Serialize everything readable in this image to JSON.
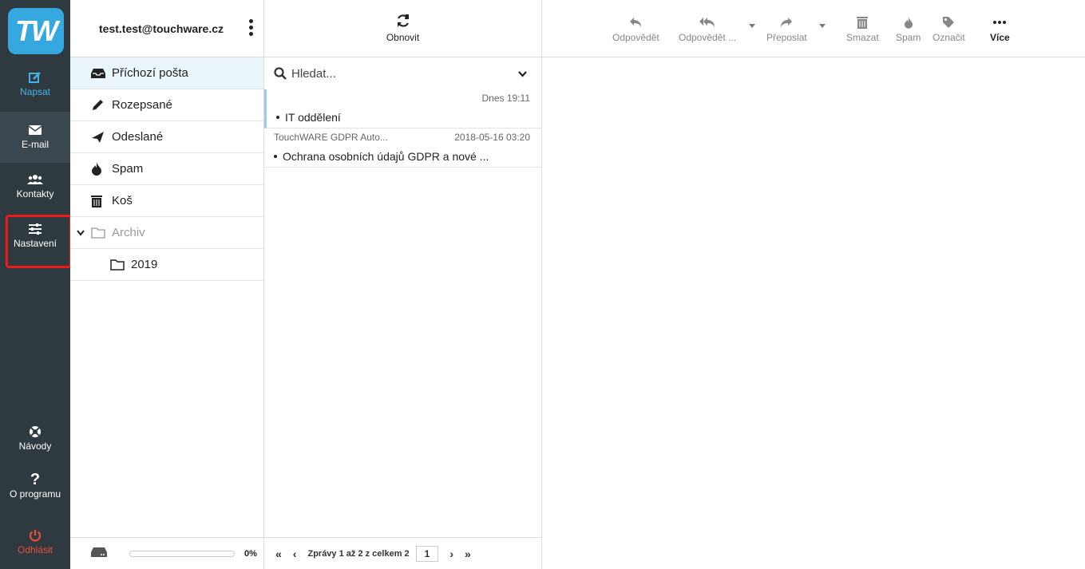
{
  "logo": "TW",
  "rail": {
    "compose": "Napsat",
    "email": "E-mail",
    "contacts": "Kontakty",
    "settings": "Nastavení",
    "guides": "Návody",
    "about": "O programu",
    "logout": "Odhlásit"
  },
  "account": "test.test@touchware.cz",
  "folders": {
    "inbox": "Příchozí pošta",
    "drafts": "Rozepsané",
    "sent": "Odeslané",
    "spam": "Spam",
    "trash": "Koš",
    "archive": "Archiv",
    "archive_2019": "2019"
  },
  "storage": {
    "percent_label": "0%",
    "used_fraction": 0
  },
  "list": {
    "refresh": "Obnovit",
    "search_placeholder": "Hledat...",
    "messages": [
      {
        "from": "",
        "date": "Dnes 19:11",
        "subject": "IT oddělení"
      },
      {
        "from": "TouchWARE GDPR Auto...",
        "date": "2018-05-16 03:20",
        "subject": "Ochrana osobních údajů GDPR a nové ..."
      }
    ],
    "pager_text": "Zprávy 1 až 2 z celkem 2",
    "page": "1"
  },
  "toolbar": {
    "reply": "Odpovědět",
    "reply_all": "Odpovědět ...",
    "forward": "Přeposlat",
    "delete": "Smazat",
    "spam": "Spam",
    "mark": "Označit",
    "more": "Více"
  }
}
